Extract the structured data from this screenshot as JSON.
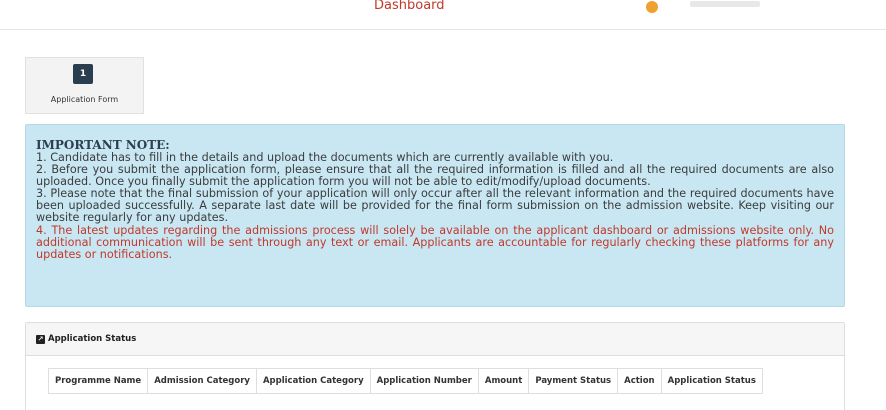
{
  "topbar": {
    "title": "Dashboard"
  },
  "steps": [
    {
      "number": "1",
      "label": "Application Form"
    }
  ],
  "note": {
    "title": "IMPORTANT NOTE:",
    "items": [
      "1. Candidate has to fill in the details and upload the documents which are currently available with you.",
      "2. Before you submit the application form, please ensure that all the required information is filled and all the required documents are also uploaded. Once you finally submit the application form you will not be able to edit/modify/upload documents.",
      "3. Please note that the final submission of your application will only occur after all the relevant information and the required documents have been uploaded successfully. A separate last date will be provided for the final form submission on the admission website. Keep visiting our website regularly for any updates.",
      "4. The latest updates regarding the admissions process will solely be available on the applicant dashboard or admissions website only. No additional communication will be sent through any text or email. Applicants are accountable for regularly checking these platforms for any updates or notifications."
    ],
    "highlight_color": "#c0392b"
  },
  "status": {
    "title": "Application Status",
    "columns": [
      "Programme Name",
      "Admission Category",
      "Application Category",
      "Application Number",
      "Amount",
      "Payment Status",
      "Action",
      "Application Status"
    ]
  }
}
